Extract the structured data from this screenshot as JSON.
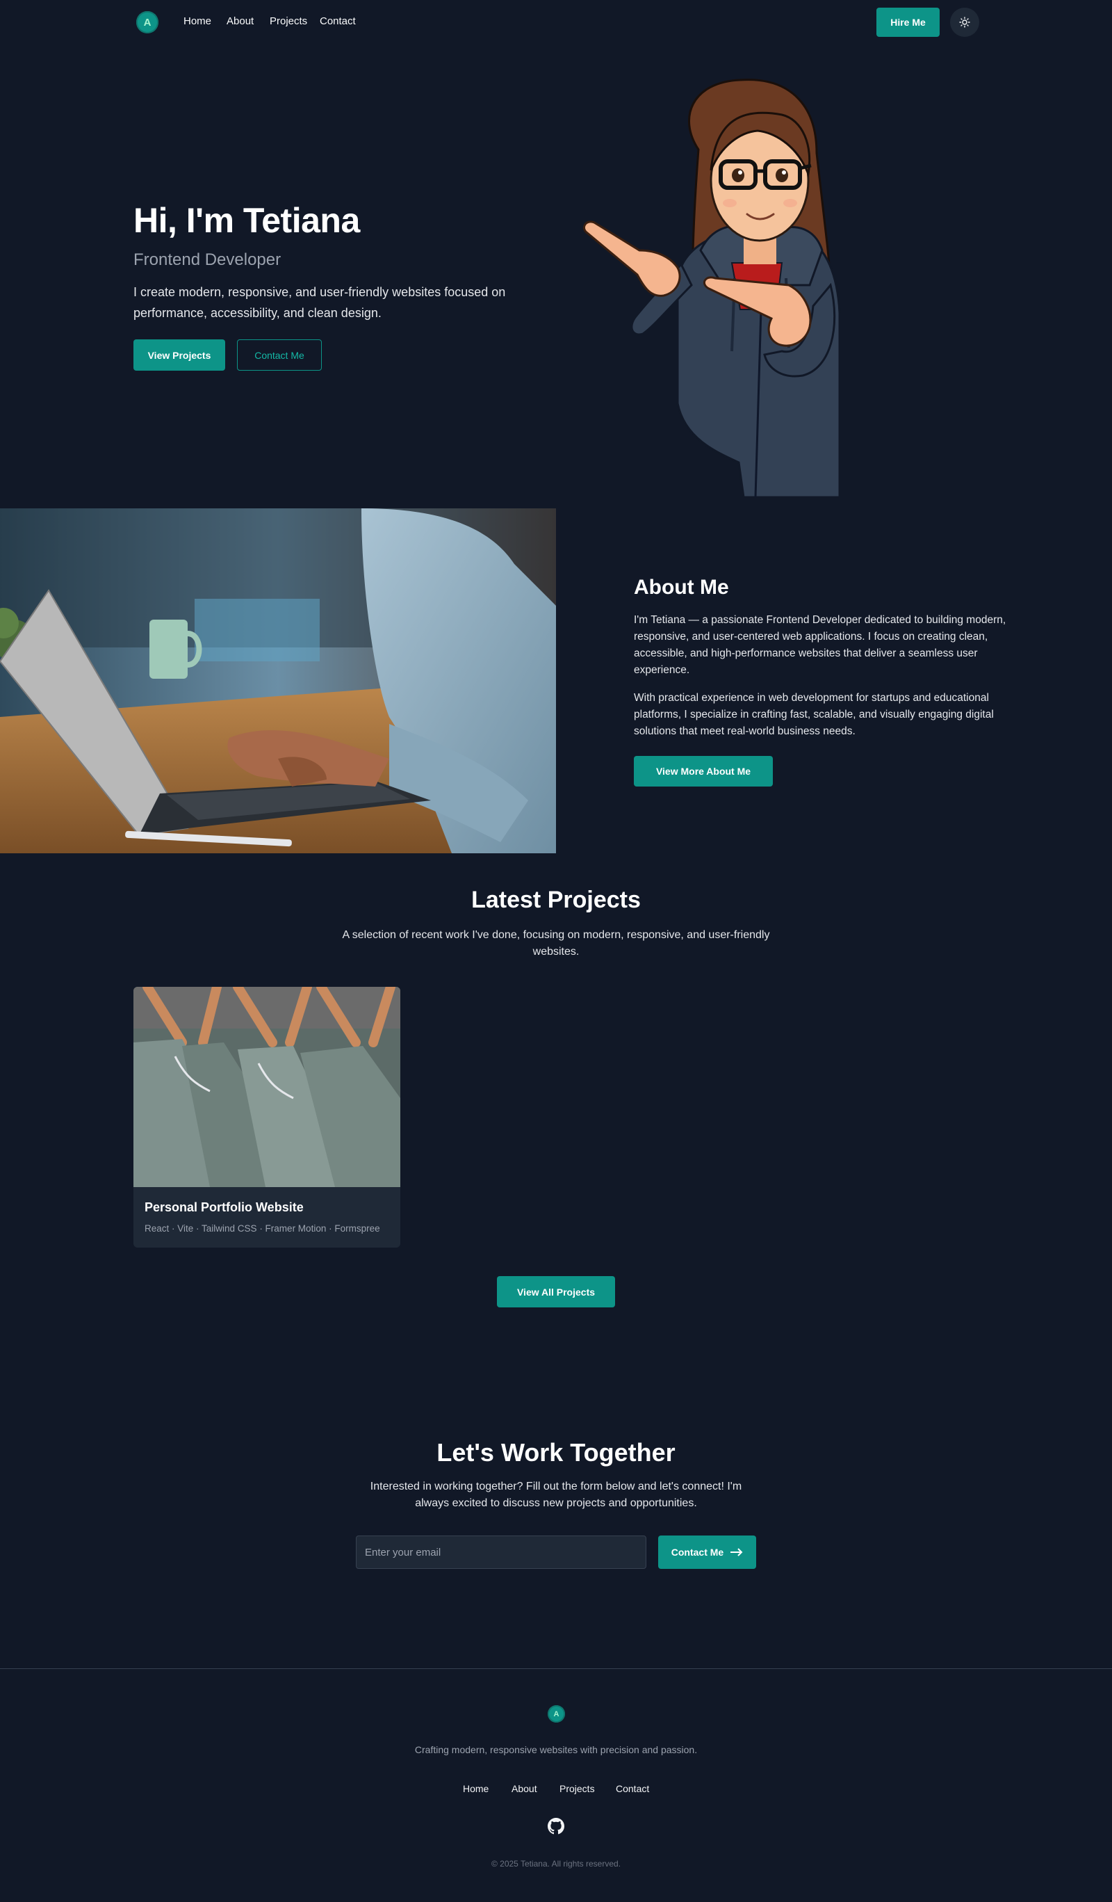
{
  "nav": {
    "logo": "A",
    "links": [
      "Home",
      "About",
      "Projects",
      "Contact"
    ],
    "hire_label": "Hire Me",
    "theme_icon": "sun-icon"
  },
  "hero": {
    "title": "Hi, I'm Tetiana",
    "subtitle": "Frontend Developer",
    "description": "I create modern, responsive, and user-friendly websites focused on performance, accessibility, and clean design.",
    "primary_label": "View Projects",
    "secondary_label": "Contact Me"
  },
  "about": {
    "title": "About Me",
    "paragraphs": [
      "I'm Tetiana — a passionate Frontend Developer dedicated to building modern, responsive, and user-centered web applications. I focus on creating clean, accessible, and high-performance websites that deliver a seamless user experience.",
      "With practical experience in web development for startups and educational platforms, I specialize in crafting fast, scalable, and visually engaging digital solutions that meet real-world business needs."
    ],
    "button_label": "View More About Me"
  },
  "projects": {
    "title": "Latest Projects",
    "description": "A selection of recent work I've done, focusing on modern, responsive, and user-friendly websites.",
    "items": [
      {
        "title": "Personal Portfolio Website",
        "tags": "React · Vite · Tailwind CSS · Framer Motion · Formspree"
      }
    ],
    "view_all_label": "View All Projects"
  },
  "cta": {
    "title": "Let's Work Together",
    "description": "Interested in working together? Fill out the form below and let's connect! I'm always excited to discuss new projects and opportunities.",
    "email_placeholder": "Enter your email",
    "button_label": "Contact Me"
  },
  "footer": {
    "logo": "A",
    "tagline": "Crafting modern, responsive websites with precision and passion.",
    "links": [
      "Home",
      "About",
      "Projects",
      "Contact"
    ],
    "social_icon": "github-icon",
    "copyright": "© 2025 Tetiana. All rights reserved."
  },
  "colors": {
    "background": "#111827",
    "accent": "#0d9488",
    "card": "#1f2937",
    "muted_text": "#9ca3af"
  }
}
